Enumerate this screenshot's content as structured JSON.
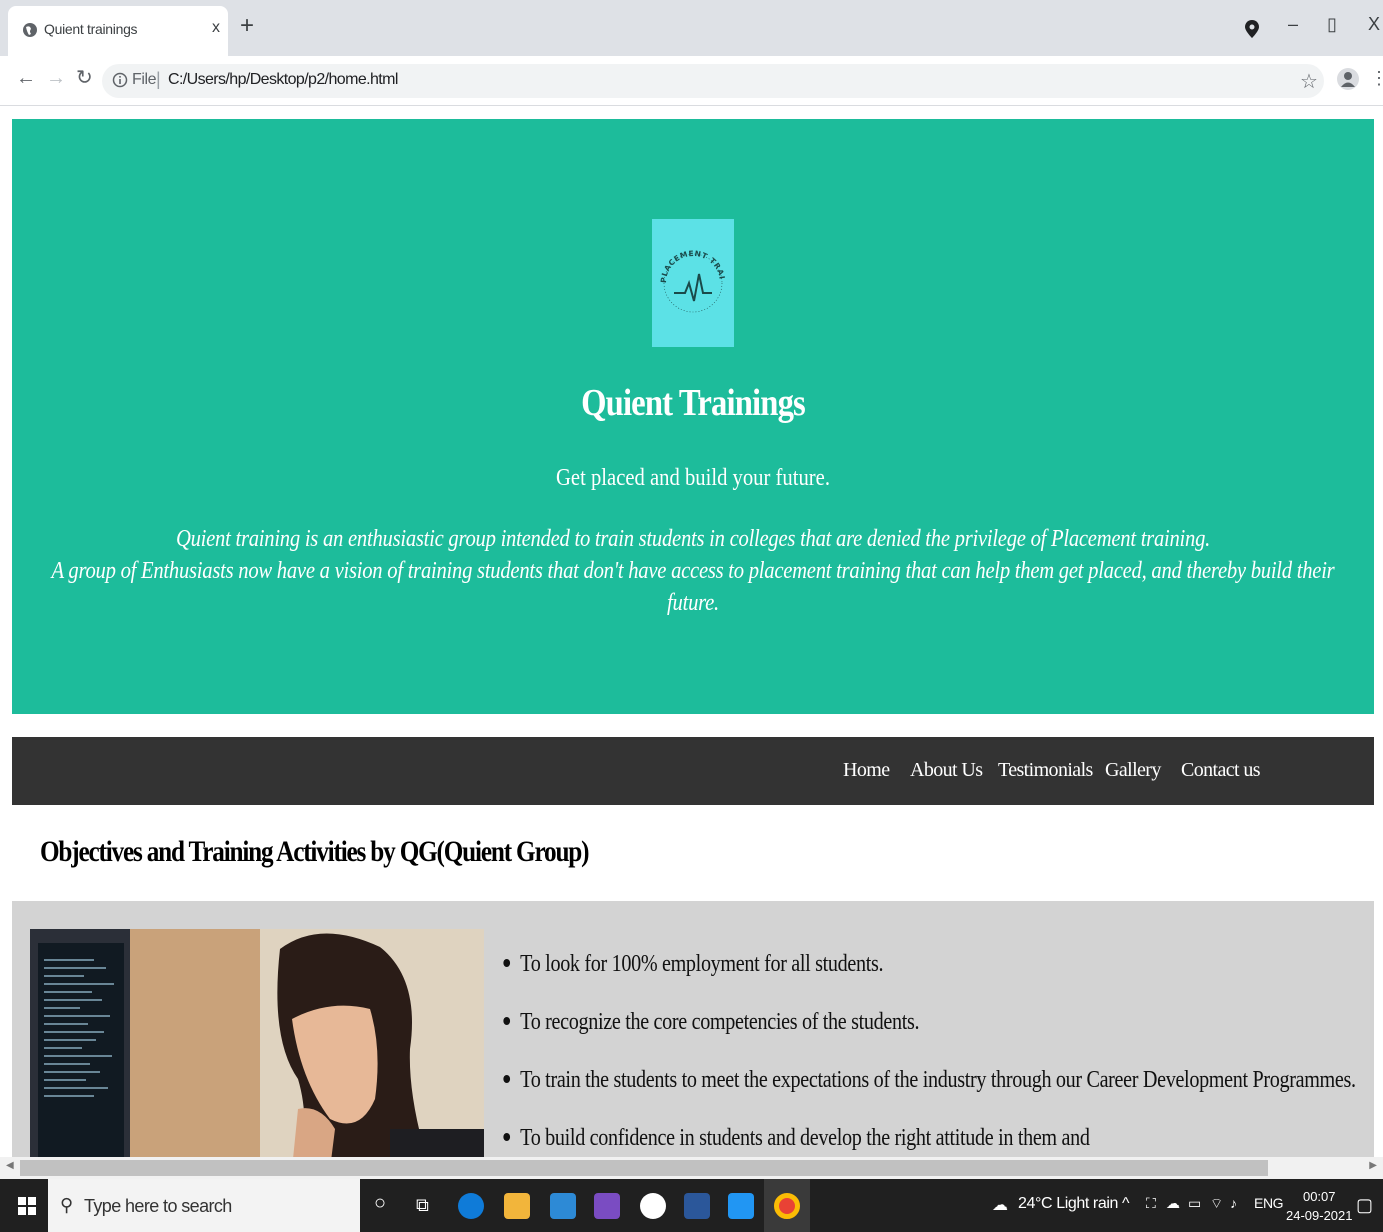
{
  "browser": {
    "tab_title": "Quient trainings",
    "tab_close": "x",
    "new_tab": "+",
    "url_scheme": "File",
    "url": "C:/Users/hp/Desktop/p2/home.html"
  },
  "hero": {
    "logo_text": "PLACEMENT TRAININGS",
    "title": "Quient Trainings",
    "tagline": "Get placed and build your future.",
    "description_line1": "Quient training is an enthusiastic group intended to train students in colleges that are denied the privilege of Placement training.",
    "description_line2": "A group of Enthusiasts now have a vision of training students that don't have access to placement training that can help them get placed, and thereby build their future.",
    "background_color": "#1dbc9b"
  },
  "nav": {
    "items": [
      {
        "label": "Home"
      },
      {
        "label": "About Us"
      },
      {
        "label": "Testimonials"
      },
      {
        "label": "Gallery"
      },
      {
        "label": "Contact us"
      }
    ]
  },
  "section": {
    "heading": "Objectives and Training Activities by QG(Quient Group)",
    "objectives": [
      "To look for 100% employment for all students.",
      "To recognize the core competencies of the students.",
      "To train the students to meet the expectations of the industry through our Career Development Programmes.",
      "To build confidence in students and develop the right attitude in them and"
    ]
  },
  "taskbar": {
    "search_placeholder": "Type here to search",
    "weather": "24°C  Light rain",
    "language": "ENG",
    "time": "00:07",
    "date": "24-09-2021"
  }
}
